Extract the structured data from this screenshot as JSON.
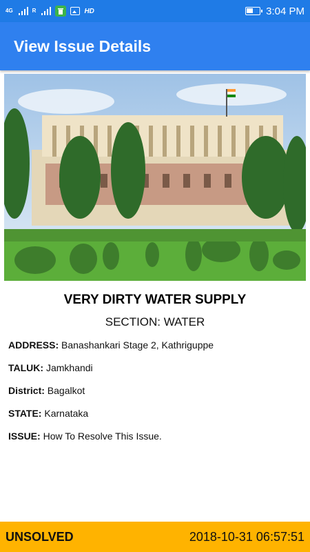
{
  "statusbar": {
    "net1": "4G",
    "net2": "R",
    "hd": "HD",
    "time": "3:04 PM",
    "battery_level": 0.55
  },
  "appbar": {
    "title": "View Issue Details"
  },
  "issue": {
    "title": "VERY DIRTY WATER SUPPLY",
    "section": "SECTION: WATER",
    "address_label": "ADDRESS:",
    "address": "Banashankari Stage 2, Kathriguppe",
    "taluk_label": "TALUK:",
    "taluk": "Jamkhandi",
    "district_label": "District:",
    "district": "Bagalkot",
    "state_label": "STATE:",
    "state": "Karnataka",
    "issue_label": "ISSUE:",
    "issue_text": "How To Resolve This Issue."
  },
  "footer": {
    "status": "UNSOLVED",
    "datetime": "2018-10-31 06:57:51"
  },
  "colors": {
    "statusbar": "#1f7be6",
    "appbar": "#2f80ef",
    "footer": "#ffb300"
  }
}
